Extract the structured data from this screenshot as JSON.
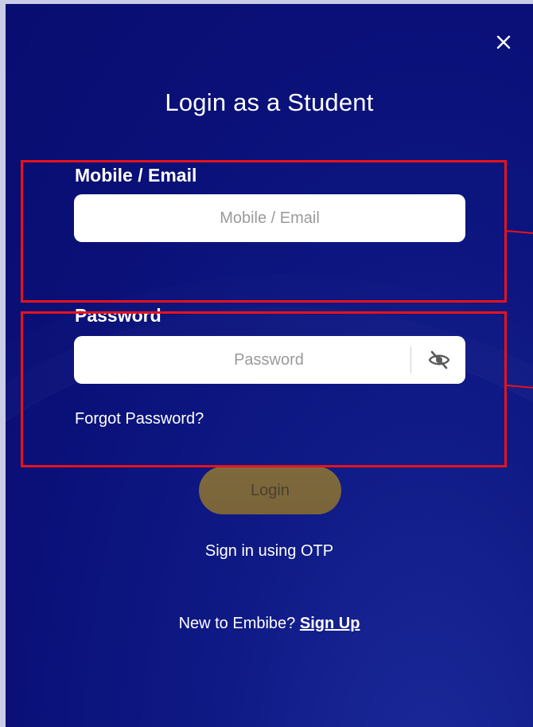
{
  "modal": {
    "title": "Login as a Student",
    "close_icon": "close-icon"
  },
  "mobile_field": {
    "label": "Mobile / Email",
    "placeholder": "Mobile / Email",
    "value": ""
  },
  "password_field": {
    "label": "Password",
    "placeholder": "Password",
    "value": "",
    "toggle_icon": "eye-slash-icon"
  },
  "links": {
    "forgot_password": "Forgot Password?",
    "sign_in_otp": "Sign in using OTP",
    "new_user_prompt": "New to Embibe?",
    "sign_up": "Sign Up"
  },
  "buttons": {
    "login": "Login"
  },
  "colors": {
    "background": "#0a1078",
    "login_button": "#7e6a3e",
    "annotation": "#e8121a"
  }
}
